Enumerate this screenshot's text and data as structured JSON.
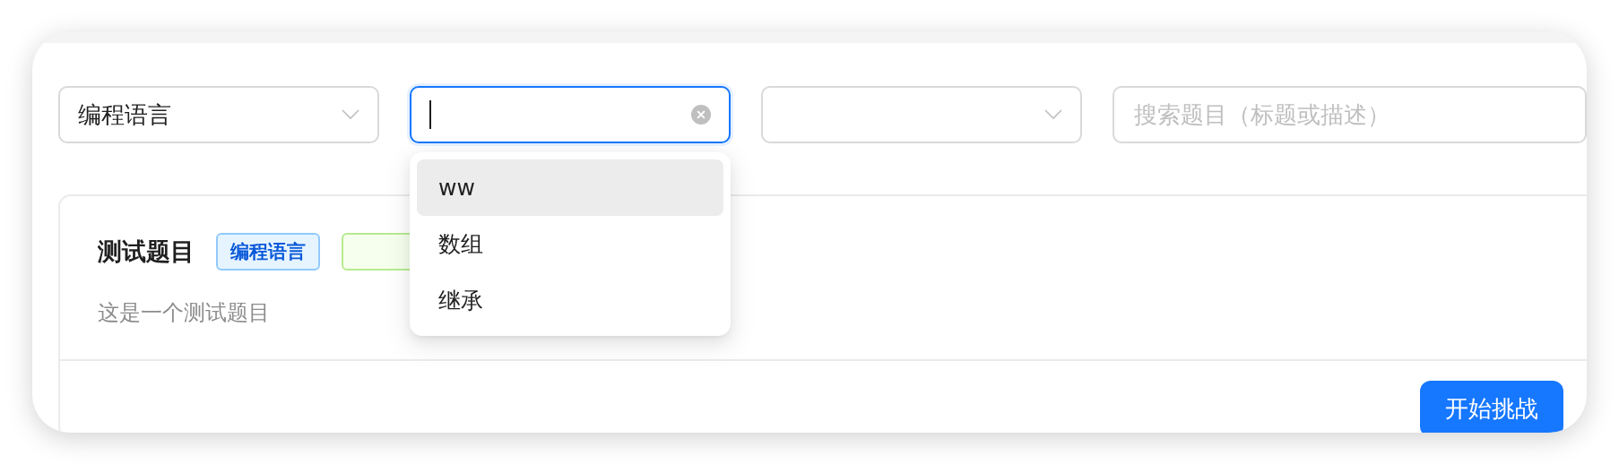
{
  "filters": [
    {
      "kind": "select",
      "value": "编程语言",
      "focused": false
    },
    {
      "kind": "select",
      "focused": true
    },
    {
      "kind": "select",
      "focused": false
    },
    {
      "kind": "search",
      "placeholder": "搜索题目（标题或描述）"
    }
  ],
  "dropdown": {
    "options": [
      {
        "label": "ww",
        "active": true
      },
      {
        "label": "数组",
        "active": false
      },
      {
        "label": "继承",
        "active": false
      }
    ]
  },
  "card": {
    "title": "测试题目",
    "tags": [
      {
        "label": "编程语言",
        "kind": "blue"
      },
      {
        "kind": "green"
      }
    ],
    "description": "这是一个测试题目",
    "button": "开始挑战"
  }
}
